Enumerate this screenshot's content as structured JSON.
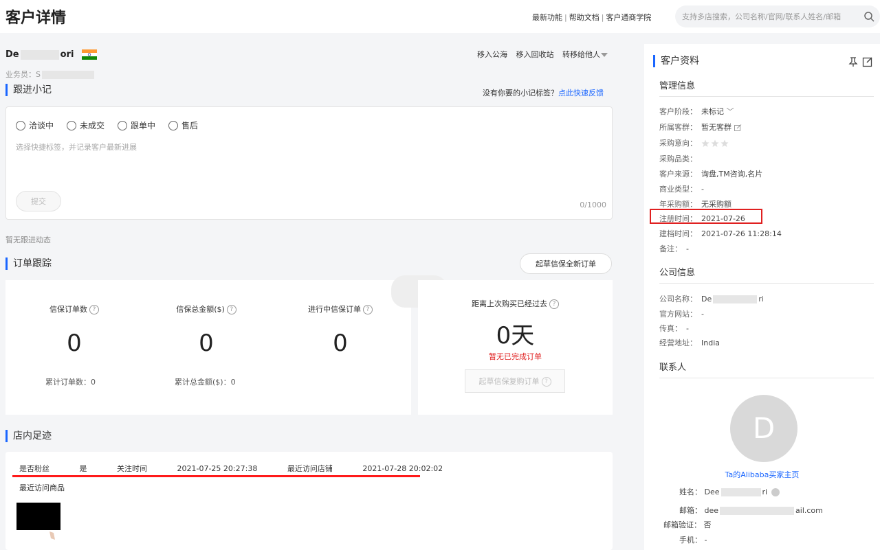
{
  "header": {
    "title": "客户详情",
    "links": [
      "最新功能",
      "帮助文档",
      "客户通商学院"
    ],
    "search_placeholder": "支持多店搜索，公司名称/官网/联系人姓名/邮箱"
  },
  "customer": {
    "name_prefix": "De",
    "name_suffix": "ori",
    "sales_label": "业务员：",
    "sales_value": "S",
    "actions": [
      "移入公海",
      "移入回收站",
      "转移给他人"
    ]
  },
  "followup": {
    "title": "跟进小记",
    "tag_tip": "没有你要的小记标签？",
    "tag_link": "点此快速反馈",
    "options": [
      "洽谈中",
      "未成交",
      "跟单中",
      "售后"
    ],
    "placeholder": "选择快捷标签，并记录客户最新进展",
    "submit": "提交",
    "counter": "0/1000",
    "empty": "暂无跟进动态"
  },
  "orders": {
    "title": "订单跟踪",
    "draft_button": "起草信保全新订单",
    "stats": [
      {
        "label": "信保订单数",
        "value": "0",
        "sub": "累计订单数：0"
      },
      {
        "label": "信保总金额($)",
        "value": "0",
        "sub": "累计总金额($)：0"
      },
      {
        "label": "进行中信保订单",
        "value": "0",
        "sub": ""
      }
    ],
    "days_label": "距离上次购买已经过去",
    "days_value": "0天",
    "no_order": "暂无已完成订单",
    "rebuy_button": "起草信保复购订单"
  },
  "footprint": {
    "title": "店内足迹",
    "fan_label": "是否粉丝",
    "fan_value": "是",
    "follow_label": "关注时间",
    "follow_value": "2021-07-25 20:27:38",
    "visit_label": "最近访问店铺",
    "visit_value": "2021-07-28 20:02:02",
    "recent_products": "最近访问商品"
  },
  "sidebar": {
    "title": "客户资料",
    "manage_title": "管理信息",
    "manage_fields": [
      {
        "k": "客户阶段：",
        "v": "未标记"
      },
      {
        "k": "所属客群：",
        "v": "暂无客群"
      },
      {
        "k": "采购意向：",
        "v": ""
      },
      {
        "k": "采购品类：",
        "v": ""
      },
      {
        "k": "客户来源：",
        "v": "询盘,TM咨询,名片"
      },
      {
        "k": "商业类型：",
        "v": "-"
      },
      {
        "k": "年采购额：",
        "v": "无采购额"
      },
      {
        "k": "注册时间：",
        "v": "2021-07-26"
      },
      {
        "k": "建档时间：",
        "v": "2021-07-26 11:28:14"
      },
      {
        "k": "备注：",
        "v": "-"
      }
    ],
    "intent_stars": 0,
    "intent_max": 3,
    "company_title": "公司信息",
    "company_fields": [
      {
        "k": "公司名称：",
        "v": "De"
      },
      {
        "k": "官方网站：",
        "v": "-"
      },
      {
        "k": "传真：",
        "v": "-"
      },
      {
        "k": "经营地址：",
        "v": "India"
      }
    ],
    "company_name_suffix": "ri",
    "contact_title": "联系人",
    "avatar_letter": "D",
    "alibaba_link": "Ta的Alibaba买家主页",
    "contact_name_label": "姓名：",
    "contact_name_prefix": "Dee",
    "contact_name_suffix": "ri",
    "contact_email_label": "邮箱：",
    "contact_email_prefix": "dee",
    "contact_email_suffix": "ail.com",
    "contact_verify_label": "邮箱验证：",
    "contact_verify_value": "否",
    "contact_phone_label": "手机：",
    "contact_phone_value": "-"
  },
  "colors": {
    "accent": "#1a66ff",
    "alert": "#e02020"
  }
}
